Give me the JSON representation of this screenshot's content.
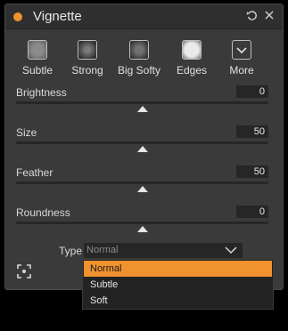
{
  "window": {
    "title": "Vignette",
    "reset_icon": "reset-icon",
    "close_icon": "close-icon",
    "accent_color": "#f0922e"
  },
  "presets": [
    {
      "label": "Subtle",
      "icon": "vignette-subtle-icon"
    },
    {
      "label": "Strong",
      "icon": "vignette-strong-icon"
    },
    {
      "label": "Big Softy",
      "icon": "vignette-big-softy-icon"
    },
    {
      "label": "Edges",
      "icon": "vignette-edges-icon"
    },
    {
      "label": "More",
      "icon": "chevron-down-box-icon"
    }
  ],
  "sliders": [
    {
      "label": "Brightness",
      "value": "0"
    },
    {
      "label": "Size",
      "value": "50"
    },
    {
      "label": "Feather",
      "value": "50"
    },
    {
      "label": "Roundness",
      "value": "0"
    }
  ],
  "type_select": {
    "label": "Type",
    "value": "Normal",
    "options": [
      "Normal",
      "Subtle",
      "Soft"
    ],
    "selected_index": 0
  },
  "footer": {
    "fit_icon": "fit-to-screen-icon"
  }
}
